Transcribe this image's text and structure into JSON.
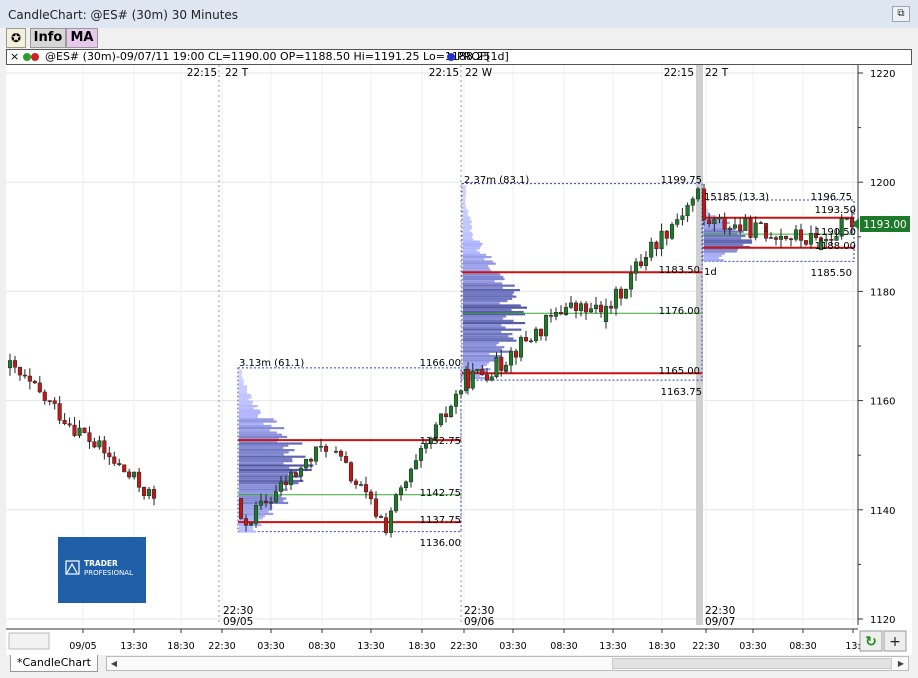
{
  "window": {
    "title": "CandleChart: @ES# (30m) 30 Minutes",
    "restore_glyph": "⧉"
  },
  "toolbar": {
    "logo_glyph": "✪",
    "info_label": "Info",
    "ma_label": "MA"
  },
  "infobar": {
    "close_glyph": "×",
    "text": "@ES# (30m)-09/07/11 19:00 CL=1190.00 OP=1188.50 Hi=1191.25 Lo=1188.25",
    "prof_label": "PROF[1d]"
  },
  "price_axis": {
    "ticks": [
      "1220",
      "1200",
      "1180",
      "1160",
      "1140",
      "1120"
    ],
    "last_price": "1193.00",
    "last_price_color": "#1e7a2a"
  },
  "time_axis": {
    "ticks": [
      "09/05",
      "13:30",
      "18:30",
      "22:30",
      "03:30",
      "08:30",
      "13:30",
      "18:30",
      "22:30",
      "03:30",
      "08:30",
      "13:30",
      "18:30",
      "22:30",
      "03:30",
      "08:30",
      "13:"
    ]
  },
  "session_marks": [
    {
      "top_time": "22:15",
      "top_day": "22 T",
      "bottom_time": "22:30",
      "bottom_date": "09/05"
    },
    {
      "top_time": "22:15",
      "top_day": "22 W",
      "bottom_time": "22:30",
      "bottom_date": "09/06"
    },
    {
      "top_time": "22:15",
      "top_day": "22 T",
      "bottom_time": "22:30",
      "bottom_date": "09/07"
    }
  ],
  "profiles": [
    {
      "volume_label": "3.13m (61.1)",
      "high": "1166.00",
      "poc": "1152.75",
      "val": "1142.75",
      "vah_low": "1137.75",
      "low": "1136.00"
    },
    {
      "volume_label": "2.37m (83.1)",
      "high": "1199.75",
      "upper": "1183.50",
      "mid": "1176.00",
      "lower": "1165.00",
      "low": "1163.75"
    },
    {
      "volume_label": "15185 (13.3)",
      "high": "1196.75",
      "upper": "1193.50",
      "mid": "1190.50",
      "lower": "1188.00",
      "low": "1185.50",
      "period": "1d"
    }
  ],
  "logo": {
    "line1": "TRADER",
    "line2": "PROFESIONAL"
  },
  "bottom": {
    "tab_label": "*CandleChart",
    "refresh_glyph": "↻",
    "plus_glyph": "+",
    "left_arrow": "◀",
    "right_arrow": "▶"
  },
  "colors": {
    "up": "#1e7a2a",
    "down": "#c01818",
    "red_line": "#cc1111",
    "green_line": "#33aa33",
    "profile_blue": "#5a5fb0",
    "logo_bg": "#1f5fa8"
  }
}
